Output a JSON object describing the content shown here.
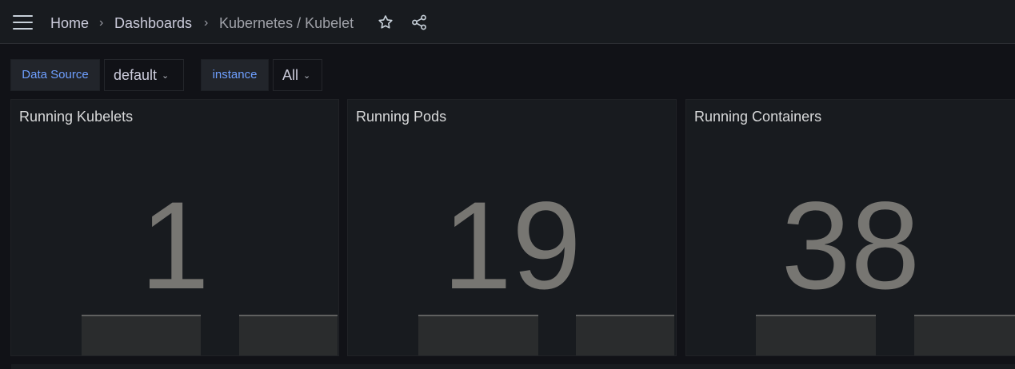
{
  "breadcrumb": {
    "home": "Home",
    "dashboards": "Dashboards",
    "current": "Kubernetes / Kubelet",
    "separator": "›"
  },
  "icons": {
    "menu": "hamburger-menu-icon",
    "star": "star-icon",
    "share": "share-icon"
  },
  "variables": [
    {
      "label": "Data Source",
      "value": "default"
    },
    {
      "label": "instance",
      "value": "All"
    }
  ],
  "panels": [
    {
      "title": "Running Kubelets",
      "value": "1"
    },
    {
      "title": "Running Pods",
      "value": "19"
    },
    {
      "title": "Running Containers",
      "value": "38"
    }
  ],
  "colors": {
    "background": "#111217",
    "panel": "#181b1f",
    "variable_label": "#6e9fff",
    "stat_value": "#777672"
  }
}
